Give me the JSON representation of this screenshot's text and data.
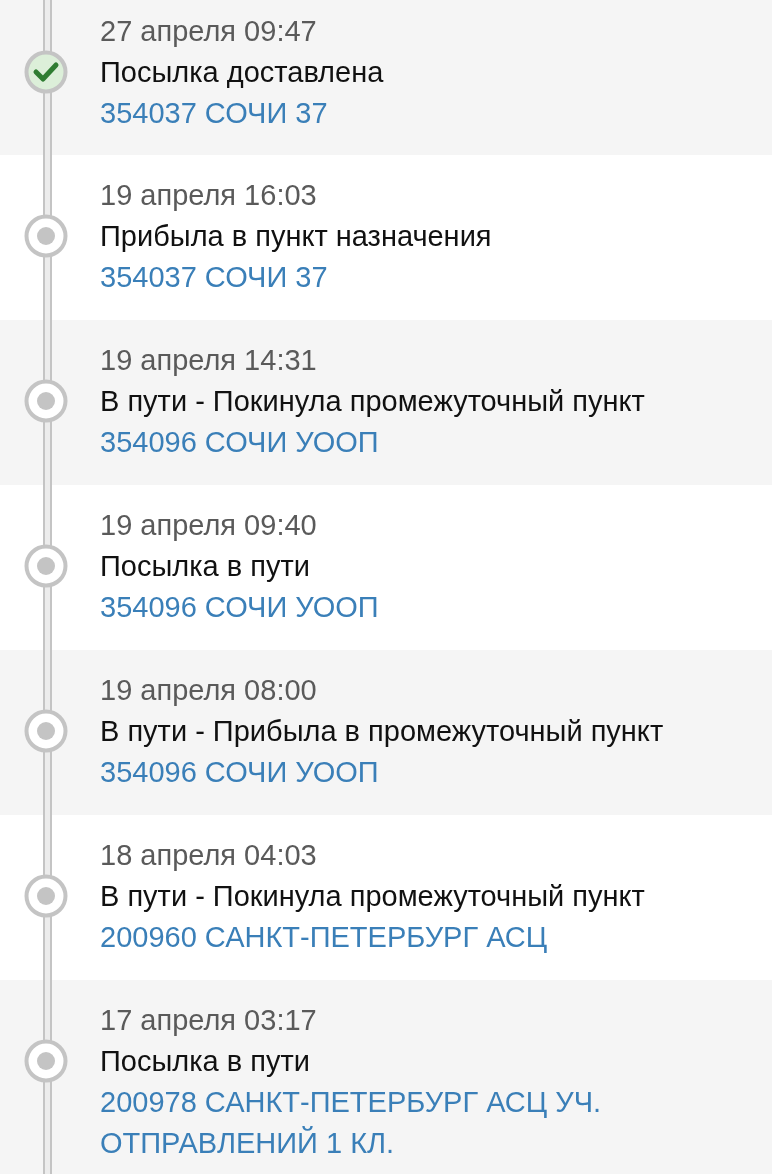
{
  "events": [
    {
      "kind": "delivered",
      "date": "27 апреля 09:47",
      "status": "Посылка доставлена",
      "location": "354037 СОЧИ 37"
    },
    {
      "kind": "transit",
      "date": "19 апреля 16:03",
      "status": "Прибыла в пункт назначения",
      "location": "354037 СОЧИ 37"
    },
    {
      "kind": "transit",
      "date": "19 апреля 14:31",
      "status": "В пути - Покинула промежуточный пункт",
      "location": "354096 СОЧИ УООП"
    },
    {
      "kind": "transit",
      "date": "19 апреля 09:40",
      "status": "Посылка в пути",
      "location": "354096 СОЧИ УООП"
    },
    {
      "kind": "transit",
      "date": "19 апреля 08:00",
      "status": "В пути - Прибыла в промежуточный пункт",
      "location": "354096 СОЧИ УООП"
    },
    {
      "kind": "transit",
      "date": "18 апреля 04:03",
      "status": "В пути - Покинула промежуточный пункт",
      "location": "200960 САНКТ-ПЕТЕРБУРГ АСЦ"
    },
    {
      "kind": "transit",
      "date": "17 апреля 03:17",
      "status": "Посылка в пути",
      "location": "200978 САНКТ-ПЕТЕРБУРГ АСЦ УЧ. ОТПРАВЛЕНИЙ 1 КЛ."
    }
  ]
}
